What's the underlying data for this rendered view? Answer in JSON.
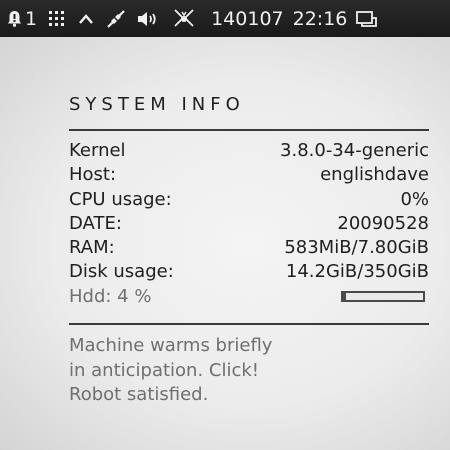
{
  "panel": {
    "notification_count": "1",
    "date": "140107",
    "time": "22:16"
  },
  "conky": {
    "title": "SYSTEM INFO",
    "rows": [
      {
        "label": "Kernel",
        "value": "3.8.0-34-generic"
      },
      {
        "label": "Host:",
        "value": "englishdave"
      },
      {
        "label": "CPU usage:",
        "value": "0%"
      },
      {
        "label": "DATE:",
        "value": "20090528"
      },
      {
        "label": "RAM:",
        "value": "583MiB/7.80GiB"
      },
      {
        "label": "Disk usage:",
        "value": "14.2GiB/350GiB"
      }
    ],
    "hdd": {
      "label": "Hdd: 4 %",
      "percent": 4
    },
    "message": [
      "Machine warms briefly",
      "in anticipation. Click!",
      "Robot satisfied."
    ]
  }
}
